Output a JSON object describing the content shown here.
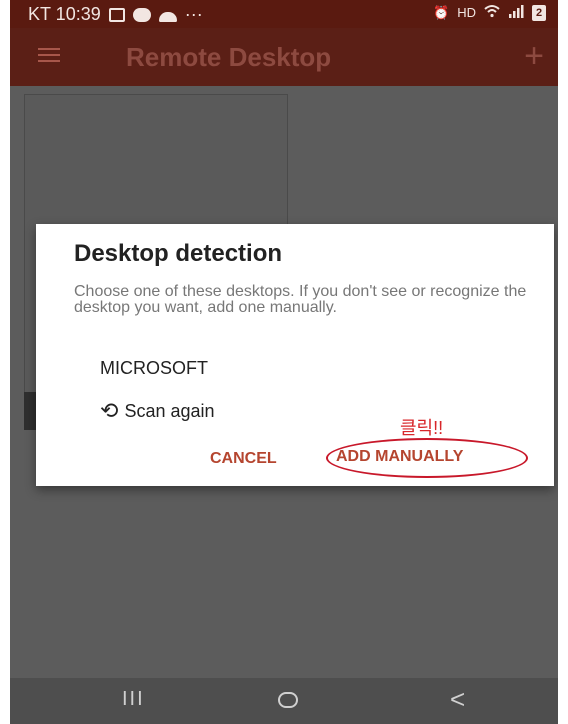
{
  "status_bar": {
    "carrier_time": "KT 10:39",
    "overflow": "···",
    "hd_label": "HD",
    "battery_label": "2",
    "icons": [
      "gallery-icon",
      "chat-icon",
      "cloud-icon",
      "alarm-icon",
      "hd-icon",
      "wifi-icon",
      "signal-icon",
      "battery-icon"
    ]
  },
  "app_bar": {
    "title": "Remote Desktop",
    "menu_icon": "hamburger-menu-icon",
    "add_icon": "plus-icon",
    "add_glyph": "+"
  },
  "dialog": {
    "title": "Desktop detection",
    "message": "Choose one of these desktops. If you don't see or recognize the desktop you want, add one manually.",
    "desktops": [
      "MICROSOFT"
    ],
    "scan_label": "Scan again",
    "scan_icon": "refresh-icon",
    "scan_glyph": "⟲",
    "cancel_label": "CANCEL",
    "add_manually_label": "ADD MANUALLY"
  },
  "annotation": {
    "text": "클릭!!",
    "color": "#d8262a"
  },
  "nav_bar": {
    "recent_glyph": "III",
    "back_glyph": "<"
  },
  "colors": {
    "app_bar": "#5b1f16",
    "accent": "#b5452f",
    "scrim_gray": "#5c5c5c"
  }
}
